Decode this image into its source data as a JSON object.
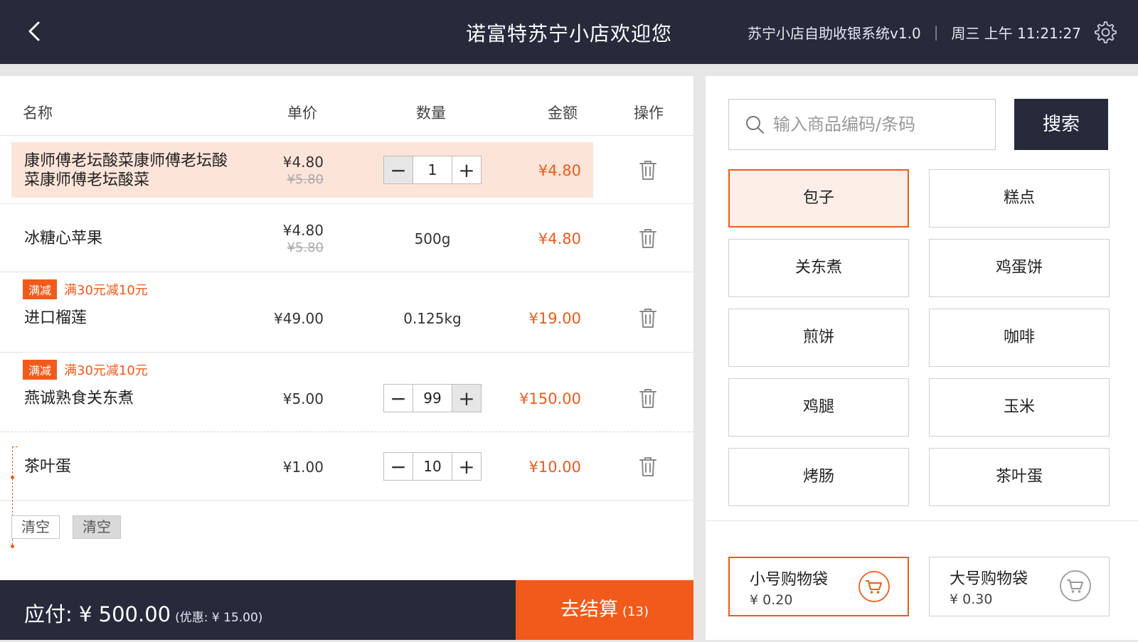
{
  "header": {
    "title": "诺富特苏宁小店欢迎您",
    "system_name": "苏宁小店自助收银系统v1.0",
    "separator": "|",
    "datetime": "周三 上午 11:21:27"
  },
  "table": {
    "headers": {
      "name": "名称",
      "price": "单价",
      "qty": "数量",
      "amount": "金额",
      "action": "操作"
    },
    "rows": [
      {
        "name_line1": "康师傅老坛酸菜康师傅老坛酸",
        "name_line2": "菜康师傅老坛酸菜",
        "price": "¥4.80",
        "old_price": "¥5.80",
        "qty": "1",
        "amount": "¥4.80"
      },
      {
        "name": "冰糖心苹果",
        "price": "¥4.80",
        "old_price": "¥5.80",
        "qty": "500g",
        "amount": "¥4.80"
      },
      {
        "promo_tag": "满减",
        "promo_text": "满30元减10元",
        "name": "进口榴莲",
        "price": "¥49.00",
        "qty": "0.125kg",
        "amount": "¥19.00"
      },
      {
        "promo_tag": "满减",
        "promo_text": "满30元减10元",
        "name": "燕诚熟食关东煮",
        "price": "¥5.00",
        "qty": "99",
        "amount": "¥150.00"
      },
      {
        "name": "茶叶蛋",
        "price": "¥1.00",
        "qty": "10",
        "amount": "¥10.00"
      }
    ]
  },
  "clear_buttons": [
    "清空",
    "清空"
  ],
  "footer": {
    "payable": "应付: ¥ 500.00",
    "discount": "(优惠: ¥ 15.00)",
    "checkout_label": "去结算",
    "checkout_count": "(13)"
  },
  "search": {
    "placeholder": "输入商品编码/条码",
    "button": "搜索"
  },
  "categories": [
    "包子",
    "糕点",
    "关东煮",
    "鸡蛋饼",
    "煎饼",
    "咖啡",
    "鸡腿",
    "玉米",
    "烤肠",
    "茶叶蛋"
  ],
  "bags": [
    {
      "name": "小号购物袋",
      "price": "¥ 0.20"
    },
    {
      "name": "大号购物袋",
      "price": "¥ 0.30"
    }
  ],
  "colors": {
    "accent": "#f15a1a",
    "dark": "#262a3b",
    "highlight": "#fde4d9"
  }
}
